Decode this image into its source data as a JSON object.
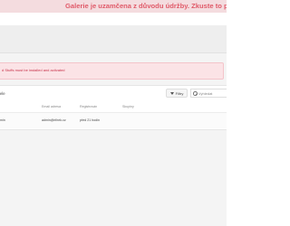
{
  "maintenance_banner": {
    "text": "Galerie je uzamčena z důvodu údržby. Zkuste to prosím poz"
  },
  "alert": {
    "text": "d Stuffs must be installed and activated"
  },
  "users_panel": {
    "title": "ele",
    "filter_label": "Filtry",
    "search_placeholder": "Vyhledat",
    "columns": [
      "",
      "Email adresa",
      "Registrován",
      "Skupiny"
    ],
    "rows": [
      {
        "user": "min",
        "email": "admin@elhek.cz",
        "registered": "před 21 hodin",
        "groups": ""
      }
    ]
  },
  "colors": {
    "banner_bg": "#f4dcdf",
    "banner_text": "#e05a69",
    "alert_bg": "#fbe3e6",
    "alert_text": "#c8324a"
  }
}
